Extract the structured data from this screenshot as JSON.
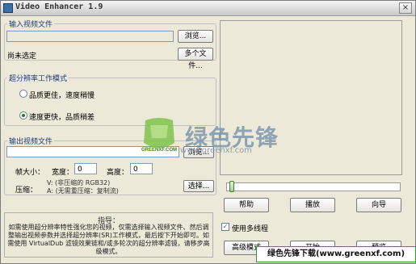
{
  "window": {
    "title": "Video Enhancer 1.9",
    "close_glyph": "×"
  },
  "input_group": {
    "legend": "输入视频文件",
    "file_value": "",
    "browse_label": "浏览...",
    "status_text": "尚未选定",
    "multi_files_label": "多个文件..."
  },
  "mode_group": {
    "legend": "超分辨率工作模式",
    "options": [
      {
        "label": "品质更佳，速度稍慢",
        "selected": false
      },
      {
        "label": "速度更快，品质稍差",
        "selected": true
      }
    ]
  },
  "output_group": {
    "legend": "输出视频文件",
    "file_value": "",
    "browse_label": "浏览...",
    "size_label": "帧大小：",
    "width_label": "宽度：",
    "width_value": "0",
    "height_label": "高度：",
    "height_value": "0",
    "compression_label": "压缩：",
    "video_codec": "V: (非压缩的 RGB32)",
    "audio_codec": "A: (无需重压缩：复制流)",
    "select_label": "选择..."
  },
  "guide": {
    "title": "指导：",
    "text": "如需使用超分辨率特性强化您的视频，仅需选择输入视频文件、然后调整输出视频参数并选择超分辨率(SR)工作模式，最后按下开始即可。如需使用 VirtualDub 滤镜效果链和/或多轮次的超分辨率滤镜，请移步高级模式。"
  },
  "right_panel": {
    "slider_position": 0,
    "help_label": "帮助",
    "play_label": "播放",
    "wizard_label": "向导",
    "multithread_label": "使用多线程",
    "multithread_checked": true,
    "advanced_label": "高级模式",
    "btn2_label": "开始",
    "btn3_label": "预览"
  },
  "watermark": {
    "logo_text": "GREENXF.COM",
    "cn_text": "绿色先锋",
    "url_text": "www.greenxf.com"
  },
  "footer_banner": {
    "text": "绿色先锋下载(www.greenxf.com)"
  },
  "colors": {
    "accent_green": "#2b7a0b",
    "legend_blue": "#1f3d7a",
    "window_bg": "#ece9d8"
  }
}
